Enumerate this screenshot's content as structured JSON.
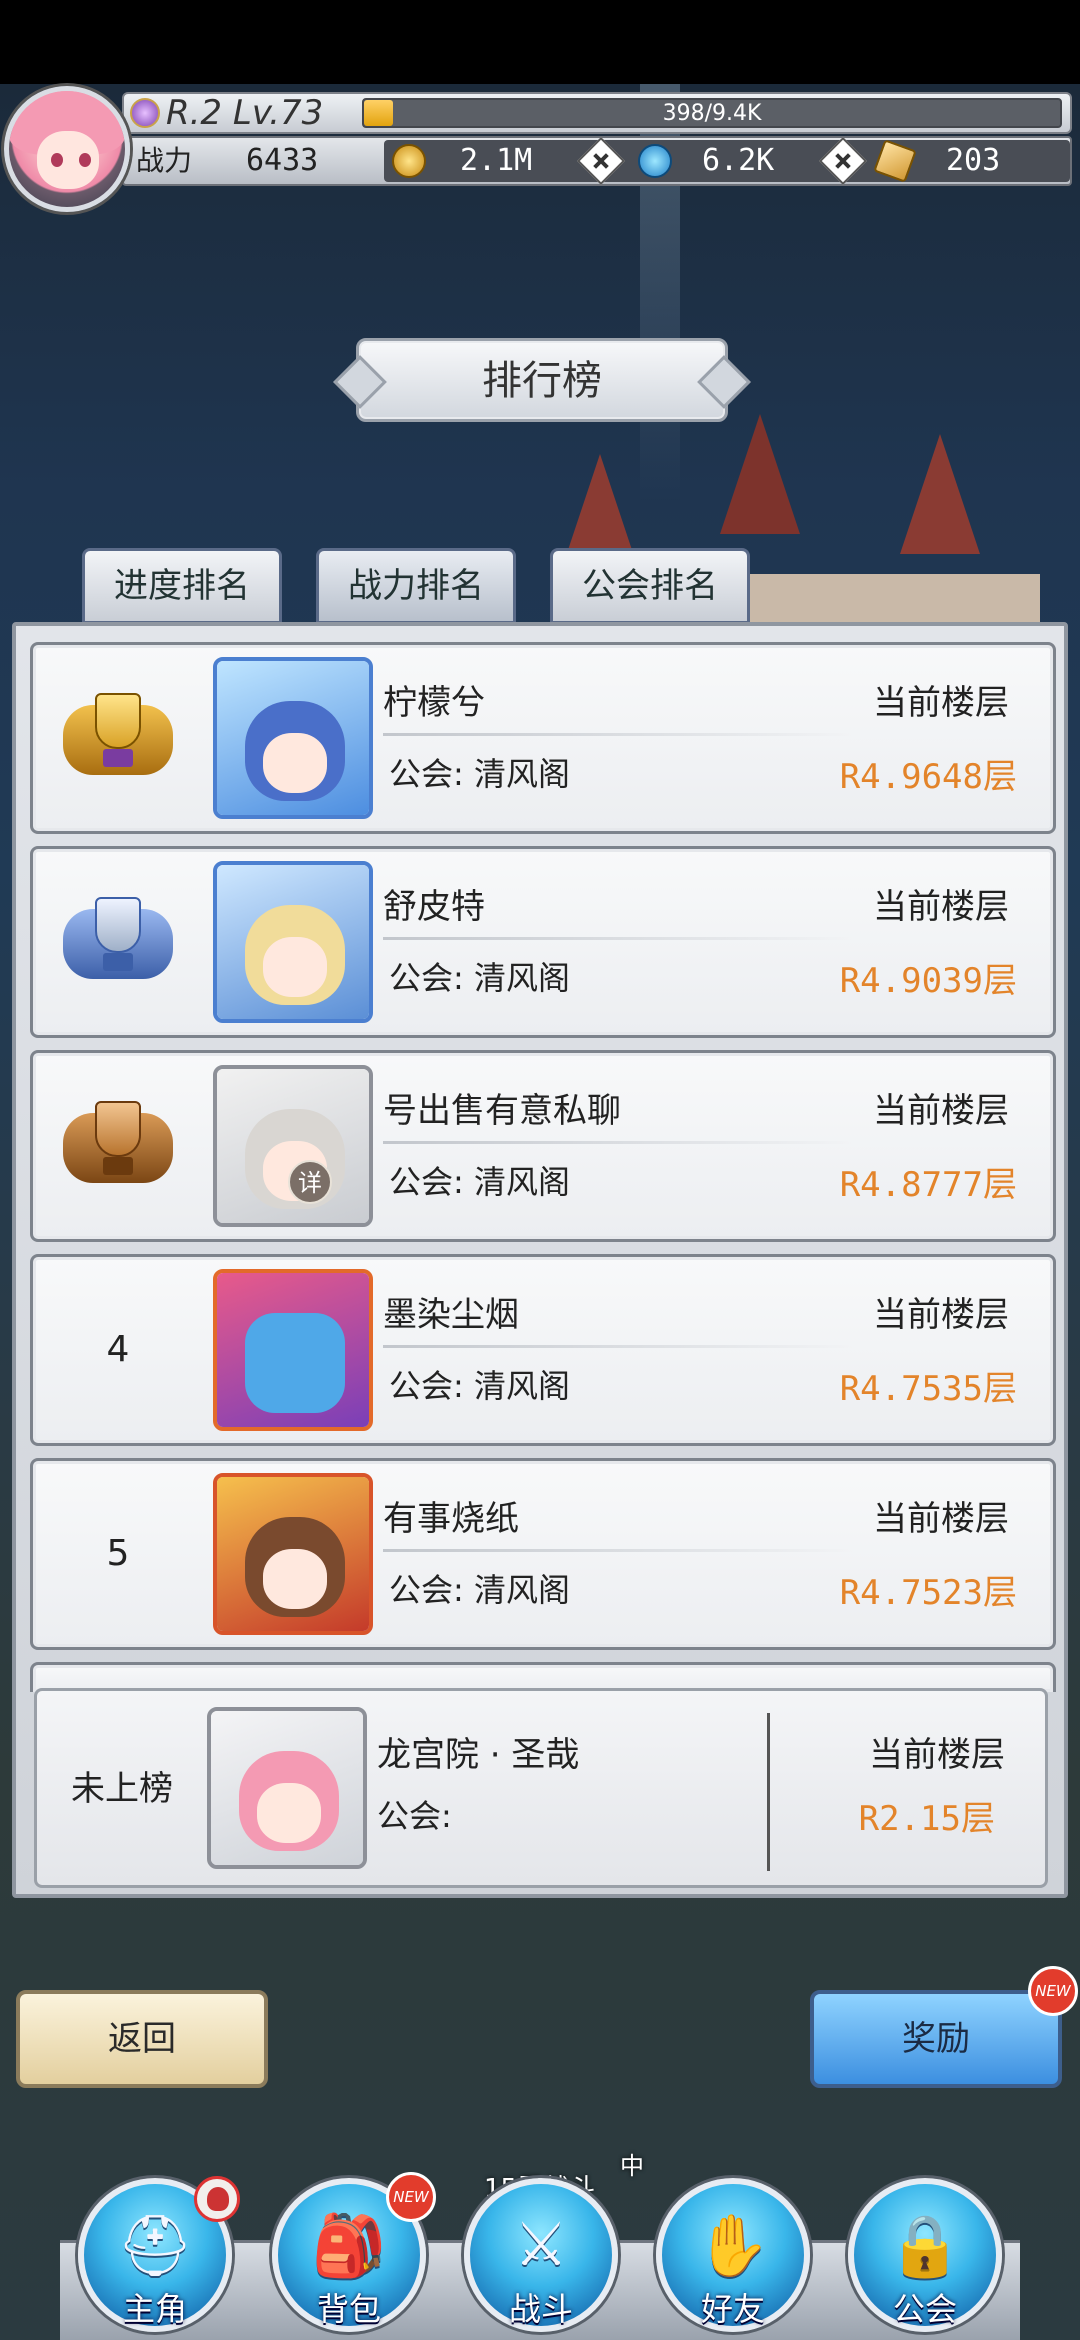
{
  "header": {
    "level_text": "R.2 Lv.73",
    "xp_text": "398/9.4K",
    "xp_progress": 0.042,
    "power_label": "战力",
    "power_value": "6433",
    "gold": "2.1M",
    "diamonds": "6.2K",
    "tickets": "203"
  },
  "title": "排行榜",
  "tabs": [
    {
      "label": "进度排名"
    },
    {
      "label": "战力排名"
    },
    {
      "label": "公会排名"
    }
  ],
  "ranking": [
    {
      "rank": "",
      "trophy": "gold",
      "name": "柠檬兮",
      "guild": "公会: 清风阁",
      "floor_label": "当前楼层",
      "floor_value": "R4.9648层"
    },
    {
      "rank": "",
      "trophy": "silver",
      "name": "舒皮特",
      "guild": "公会: 清风阁",
      "floor_label": "当前楼层",
      "floor_value": "R4.9039层"
    },
    {
      "rank": "",
      "trophy": "bronze",
      "name": "号出售有意私聊",
      "guild": "公会: 清风阁",
      "floor_label": "当前楼层",
      "floor_value": "R4.8777层"
    },
    {
      "rank": "4",
      "trophy": "",
      "name": "墨染尘烟",
      "guild": "公会: 清风阁",
      "floor_label": "当前楼层",
      "floor_value": "R4.7535层"
    },
    {
      "rank": "5",
      "trophy": "",
      "name": "有事烧纸",
      "guild": "公会: 清风阁",
      "floor_label": "当前楼层",
      "floor_value": "R4.7523层"
    }
  ],
  "me": {
    "rank": "未上榜",
    "name": "龙宫院 · 圣哉",
    "guild": "公会:",
    "floor_label": "当前楼层",
    "floor_value": "R2.15层",
    "detail": "详"
  },
  "buttons": {
    "back": "返回",
    "reward": "奖励",
    "new_badge": "NEW"
  },
  "nav": {
    "battle_status": "15层战斗",
    "battle_sup": "中",
    "items": [
      {
        "label": "主角"
      },
      {
        "label": "背包"
      },
      {
        "label": "战斗"
      },
      {
        "label": "好友"
      },
      {
        "label": "公会"
      }
    ]
  },
  "colors": {
    "floor_value": "#e3842a",
    "gold_trophy": "#d9a227",
    "silver_trophy": "#6e8fd8",
    "bronze_trophy": "#b8742e",
    "nav_blue": "#39b6ea",
    "new_badge": "#e23c2c"
  }
}
